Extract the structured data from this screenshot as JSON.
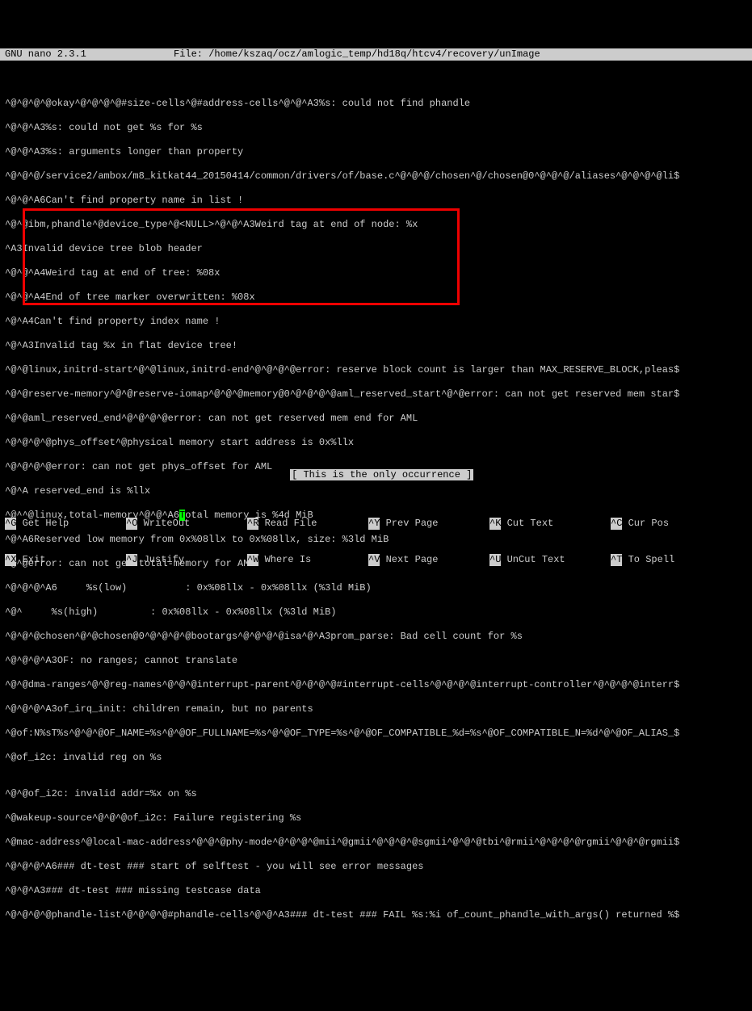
{
  "titlebar": {
    "app": "GNU nano 2.3.1",
    "file_label": "File: /home/kszaq/ocz/amlogic_temp/hd18q/htcv4/recovery/unImage"
  },
  "lines": {
    "l01": "^@^@^@^@okay^@^@^@^@#size-cells^@#address-cells^@^@^A3%s: could not find phandle",
    "l02": "^@^@^A3%s: could not get %s for %s",
    "l03": "^@^@^A3%s: arguments longer than property",
    "l04": "^@^@^@/service2/ambox/m8_kitkat44_20150414/common/drivers/of/base.c^@^@^@/chosen^@/chosen@0^@^@^@/aliases^@^@^@^@li$",
    "l05": "^@^@^A6Can't find property name in list !",
    "l06": "^@^@ibm,phandle^@device_type^@<NULL>^@^@^A3Weird tag at end of node: %x",
    "l07": "^A3Invalid device tree blob header",
    "l08": "^@^@^A4Weird tag at end of tree: %08x",
    "l09": "^@^@^A4End of tree marker overwritten: %08x",
    "l10": "^@^A4Can't find property index name !",
    "l11": "^@^A3Invalid tag %x in flat device tree!",
    "l12": "^@^@linux,initrd-start^@^@linux,initrd-end^@^@^@^@error: reserve block count is larger than MAX_RESERVE_BLOCK,pleas$",
    "l13": "^@^@reserve-memory^@^@reserve-iomap^@^@^@memory@0^@^@^@^@aml_reserved_start^@^@error: can not get reserved mem star$",
    "l14": "^@^@aml_reserved_end^@^@^@^@error: can not get reserved mem end for AML",
    "l15": "^@^@^@^@phys_offset^@physical memory start address is 0x%llx",
    "l16": "^@^@^@^@error: can not get phys_offset for AML",
    "l17": "^@^A reserved_end is %llx",
    "l18a": "^@^",
    "l18b": "^@linux,total-memory^@^@^A6",
    "l18cursor": "T",
    "l18c": "otal memory is %4d MiB",
    "l19a": "^@^",
    "l19b": "A6Reserved low memory from 0x%08llx to 0x%08llx, size: %3ld MiB",
    "l20a": "^@^",
    "l20b": "@error: can not get total-memory for AML",
    "l21a": "^@^",
    "l21b": "@^@^A6     %s(low)          : 0x%08llx - 0x%08llx (%3ld MiB)",
    "l22a": "^@^",
    "l22b": "     %s(high)         : 0x%08llx - 0x%08llx (%3ld MiB)",
    "l23a": "^@^",
    "l23b": "@^@chosen^@^@chosen@0^@^@^@^@bootargs^@^@^@^@isa^@^A3prom_parse:",
    "l23c": " Bad cell count for %s",
    "l24a": "^@^",
    "l24b": "@^@^A3OF: no ranges; cannot translate",
    "l25": "^@^@dma-ranges^@^@reg-names^@^@^@interrupt-parent^@^@^@^@#interrupt-cells^@^@^@^@interrupt-controller^@^@^@^@interr$",
    "l26": "^@^@^@^A3of_irq_init: children remain, but no parents",
    "l27": "^@of:N%sT%s^@^@^@OF_NAME=%s^@^@OF_FULLNAME=%s^@^@OF_TYPE=%s^@^@OF_COMPATIBLE_%d=%s^@OF_COMPATIBLE_N=%d^@^@OF_ALIAS_$",
    "l28": "^@of_i2c: invalid reg on %s",
    "l29": "",
    "l30": "^@^@of_i2c: invalid addr=%x on %s",
    "l31": "^@wakeup-source^@^@^@of_i2c: Failure registering %s",
    "l32": "^@mac-address^@local-mac-address^@^@^@phy-mode^@^@^@^@mii^@gmii^@^@^@^@sgmii^@^@^@tbi^@rmii^@^@^@^@rgmii^@^@^@rgmii$",
    "l33": "^@^@^@^A6### dt-test ### start of selftest - you will see error messages",
    "l34": "^@^@^A3### dt-test ### missing testcase data",
    "l35": "^@^@^@^@phandle-list^@^@^@^@#phandle-cells^@^@^A3### dt-test ### FAIL %s:%i of_count_phandle_with_args() returned %$"
  },
  "status": {
    "message": "[ This is the only occurrence ]"
  },
  "menu": {
    "k1": "^G",
    "l1": "Get Help",
    "k2": "^O",
    "l2": "WriteOut",
    "k3": "^R",
    "l3": "Read File",
    "k4": "^Y",
    "l4": "Prev Page",
    "k5": "^K",
    "l5": "Cut Text",
    "k6": "^C",
    "l6": "Cur Pos",
    "k7": "^X",
    "l7": "Exit",
    "k8": "^J",
    "l8": "Justify",
    "k9": "^W",
    "l9": "Where Is",
    "k10": "^V",
    "l10": "Next Page",
    "k11": "^U",
    "l11": "UnCut Text",
    "k12": "^T",
    "l12": "To Spell"
  }
}
